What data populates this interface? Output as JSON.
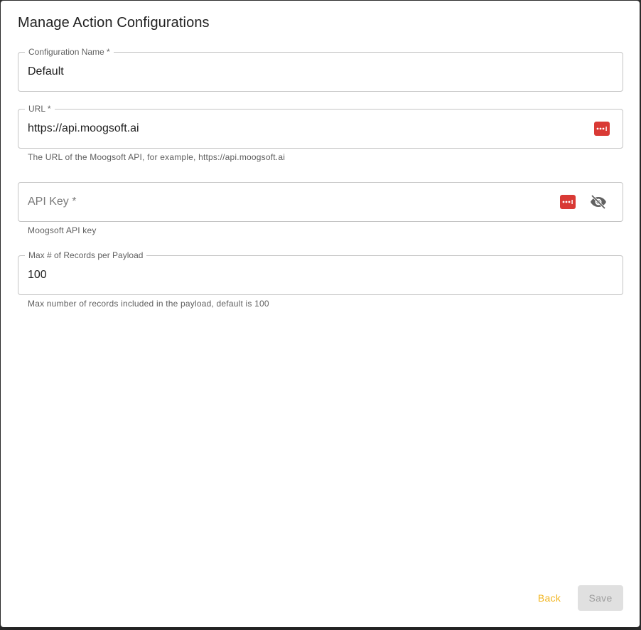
{
  "dialog": {
    "title": "Manage Action Configurations"
  },
  "fields": {
    "config_name": {
      "label": "Configuration Name *",
      "value": "Default"
    },
    "url": {
      "label": "URL *",
      "value": "https://api.moogsoft.ai",
      "helper": "The URL of the Moogsoft API, for example, https://api.moogsoft.ai"
    },
    "api_key": {
      "placeholder": "API Key *",
      "value": "",
      "helper": "Moogsoft API key"
    },
    "max_records": {
      "label": "Max # of Records per Payload",
      "value": "100",
      "helper": "Max number of records included in the payload, default is 100"
    }
  },
  "icons": {
    "password_manager": "password-manager-icon",
    "visibility_off": "eye-off-icon"
  },
  "actions": {
    "back_label": "Back",
    "save_label": "Save"
  },
  "colors": {
    "accent": "#f2b51f",
    "password_manager": "#d93a35",
    "disabled_bg": "#e0e0e0",
    "disabled_text": "#9e9e9e"
  }
}
